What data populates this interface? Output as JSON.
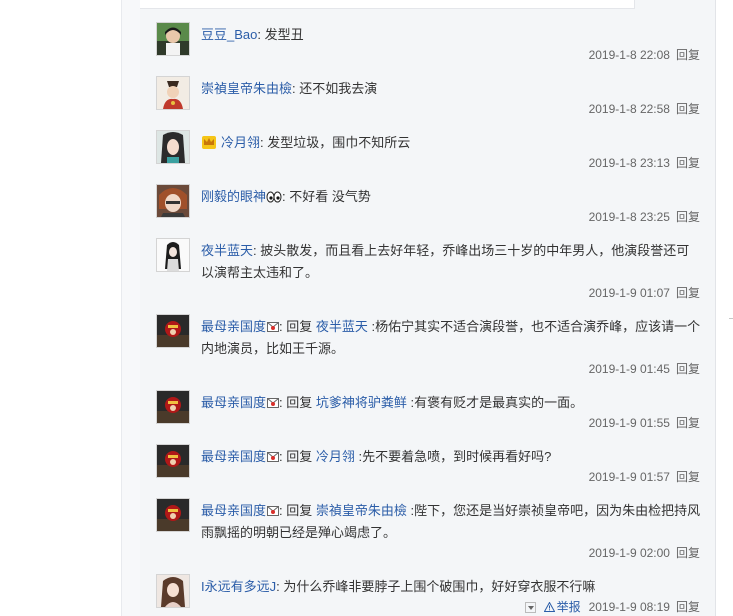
{
  "comments": [
    {
      "user": "豆豆_Bao",
      "sep": ": ",
      "text": "发型丑",
      "time": "2019-1-8 22:08",
      "reply": "回复"
    },
    {
      "user": "崇禎皇帝朱由檢",
      "sep": ": ",
      "text": "还不如我去演",
      "time": "2019-1-8 22:58",
      "reply": "回复"
    },
    {
      "user": "冷月翎",
      "sep": ": ",
      "text": "发型垃圾，围巾不知所云",
      "time": "2019-1-8 23:13",
      "reply": "回复"
    },
    {
      "user": "刚毅的眼神",
      "sep": ": ",
      "text": "不好看 没气势",
      "time": "2019-1-8 23:25",
      "reply": "回复"
    },
    {
      "user": "夜半蓝天",
      "sep": ": ",
      "text": "披头散发，而且看上去好年轻，乔峰出场三十岁的中年男人，他演段誉还可以演帮主太违和了。",
      "time": "2019-1-9 01:07",
      "reply": "回复"
    },
    {
      "user": "最母亲国度",
      "sep": ": ",
      "prefix": "回复 ",
      "ref": "夜半蓝天",
      "text": " :杨佑宁其实不适合演段誉，也不适合演乔峰，应该请一个内地演员，比如王千源。",
      "time": "2019-1-9 01:45",
      "reply": "回复"
    },
    {
      "user": "最母亲国度",
      "sep": ": ",
      "prefix": "回复 ",
      "ref": "坑爹神将驴粪鲜",
      "text": " :有褒有贬才是最真实的一面。",
      "time": "2019-1-9 01:55",
      "reply": "回复"
    },
    {
      "user": "最母亲国度",
      "sep": ": ",
      "prefix": "回复 ",
      "ref": "冷月翎",
      "text": " :先不要着急喷，到时候再看好吗?",
      "time": "2019-1-9 01:57",
      "reply": "回复"
    },
    {
      "user": "最母亲国度",
      "sep": ": ",
      "prefix": "回复 ",
      "ref": "崇禎皇帝朱由檢",
      "text": " :陛下，您还是当好崇祯皇帝吧，因为朱由检把持风雨飘摇的明朝已经是殚心竭虑了。",
      "time": "2019-1-9 02:00",
      "reply": "回复"
    },
    {
      "user": "I永远有多远J",
      "sep": ": ",
      "text": "为什么乔峰非要脖子上围个破围巾，好好穿衣服不行嘛",
      "time": "2019-1-9 08:19",
      "reply": "回复",
      "report": "举报"
    }
  ]
}
